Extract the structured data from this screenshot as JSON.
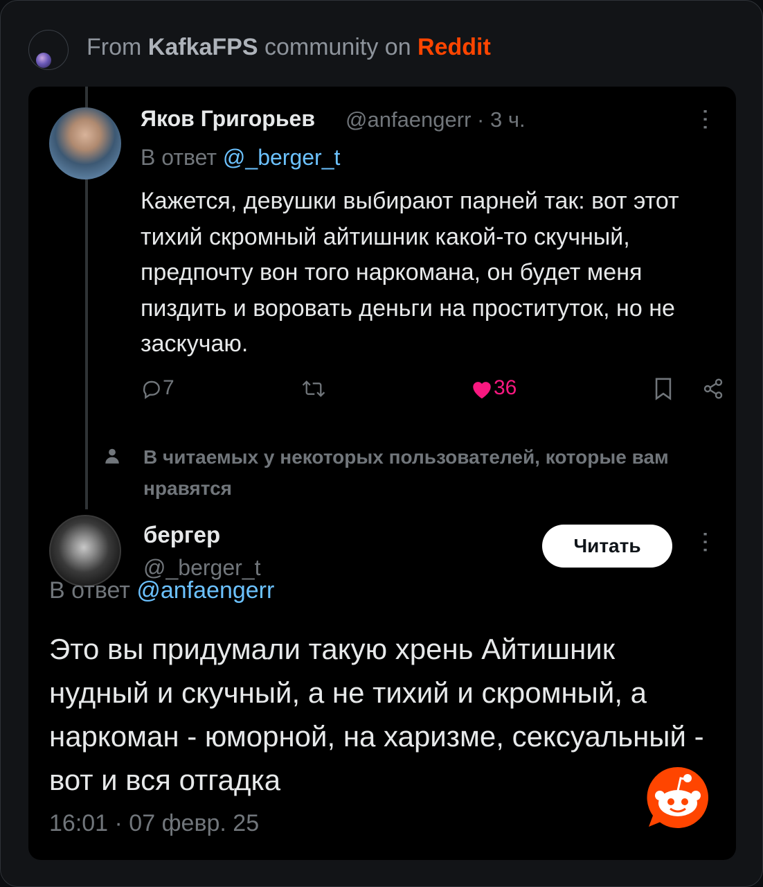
{
  "header": {
    "prefix": "From ",
    "community": "KafkaFPS",
    "middle": " community on ",
    "platform": "Reddit"
  },
  "tweet": {
    "author_name": "Яков Григорьев",
    "author_handle": "@anfaengerr · 3 ч.",
    "reply_prefix": "В ответ ",
    "reply_mention": "@_berger_t",
    "text": "Кажется, девушки выбирают парней так: вот этот тихий скромный айтишник какой-то скучный, предпочту вон того наркомана, он будет меня пиздить и воровать деньги на проституток, но не заскучаю.",
    "replies": "7",
    "likes": "36",
    "icons": [
      "comment-icon",
      "retweet-icon",
      "heart-icon",
      "bookmark-icon",
      "share-icon",
      "more-icon"
    ]
  },
  "social_context": "В читаемых у некоторых пользователей, которые вам нравятся",
  "reply": {
    "author_name": "бергер",
    "author_handle": "@_berger_t",
    "follow_label": "Читать",
    "reply_prefix": "В ответ ",
    "reply_mention": "@anfaengerr",
    "text": "Это вы придумали такую хрень Айтишник нудный и скучный, а не тихий и скромный, а наркоман - юморной, на харизме, сексуальный - вот и вся отгадка",
    "timestamp": "16:01 · 07 февр. 25"
  },
  "colors": {
    "reddit": "#ff4500",
    "like": "#f91880",
    "mention": "#6cc2ff",
    "muted": "#71767b",
    "text": "#e7e9ea"
  }
}
